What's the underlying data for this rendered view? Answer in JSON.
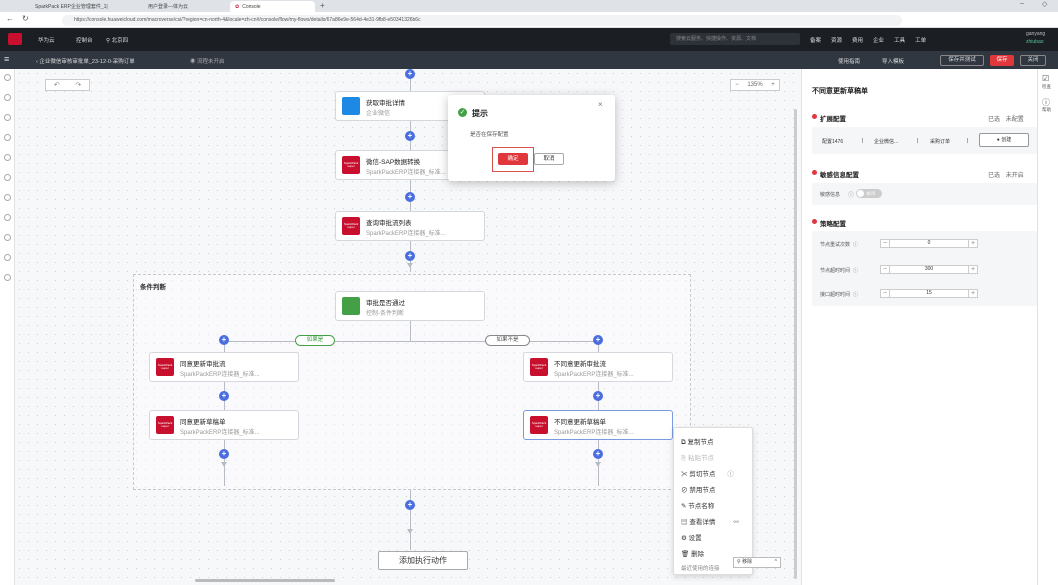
{
  "browser": {
    "tabs": [
      {
        "label": "SparkPack ERP企业管理套件_1|"
      },
      {
        "label": "用户登录—体为云"
      },
      {
        "label": "Console"
      }
    ],
    "url": "https://console.huaweicloud.com/macroverse/csi/?region=cn-north-4&locale=zh-cn#/console/flow/my-flows/details/67a86e9e-564d-4e31-9fb8-e50341326b6c"
  },
  "topbar": {
    "logo_label": "华为云",
    "console_label": "控制台",
    "region_label": "北京四",
    "search_placeholder": "搜索云服务、快捷操作、资源、文档",
    "nav": [
      "备案",
      "资源",
      "费用",
      "企业",
      "工具",
      "工单"
    ],
    "user_name": "ganyang",
    "user_sub": "zhiubao"
  },
  "subbar": {
    "breadcrumb": "企业微信审核审批单_23-12-0-采购订单",
    "status": "流程未开启",
    "help_label": "使用指南",
    "import_label": "导入模板",
    "save_test_label": "保存并测试",
    "save_label": "保存",
    "close_label": "关闭"
  },
  "canvas": {
    "zoom": "135%",
    "nodes": {
      "approval_detail": {
        "title": "获取审批详情",
        "sub": "企业微信"
      },
      "wechat_sap": {
        "title": "微信-SAP数据转换",
        "sub": "SparkPackERP连接器_标准..."
      },
      "query_flow": {
        "title": "查询审批流列表",
        "sub": "SparkPackERP连接器_标准..."
      },
      "approval_pass": {
        "title": "审批是否通过",
        "sub": "控制-条件判断"
      },
      "agree_flow": {
        "title": "同意更新审批流",
        "sub": "SparkPackERP连接器_标准..."
      },
      "disagree_flow": {
        "title": "不同意更新审批流",
        "sub": "SparkPackERP连接器_标准..."
      },
      "agree_draft": {
        "title": "同意更新草稿单",
        "sub": "SparkPackERP连接器_标准..."
      },
      "disagree_draft": {
        "title": "不同意更新草稿单",
        "sub": "SparkPackERP连接器_标准..."
      }
    },
    "ic_text": "SparkPack\nsuper",
    "condition_label": "条件判断",
    "branch_yes": "如果是",
    "branch_no": "如果不是",
    "add_action": "添加执行动作"
  },
  "dialog": {
    "title": "提示",
    "message": "是否在保存配置",
    "confirm": "确定",
    "cancel": "取消"
  },
  "context_menu": {
    "items": [
      "复制节点",
      "粘贴节点",
      "剪切节点",
      "禁用节点",
      "节点名称",
      "查看详情",
      "设置",
      "删除"
    ],
    "footer": "最近使用的连接",
    "footer_select": "移除"
  },
  "right_panel": {
    "title": "不同意更新草稿单",
    "ext_config": "扩展配置",
    "ext_status_done": "已选",
    "ext_status_todo": "未配置",
    "ext_fields": [
      "配置1476",
      "企业微信...",
      "采购订单"
    ],
    "ext_btn": "创建",
    "sensitive_config": "敏感信息配置",
    "sensitive_status_done": "已选",
    "sensitive_status_todo": "未开启",
    "sensitive_label": "敏感信息",
    "sensitive_toggle": "关闭",
    "policy_config": "策略配置",
    "retry_label": "节点重试次数",
    "retry_value": "0",
    "timeout_label": "节点超时时间",
    "timeout_value": "300",
    "interval_label": "接口超时时间",
    "interval_value": "15"
  },
  "right_rail": {
    "item1": "检查",
    "item2": "帮助"
  }
}
